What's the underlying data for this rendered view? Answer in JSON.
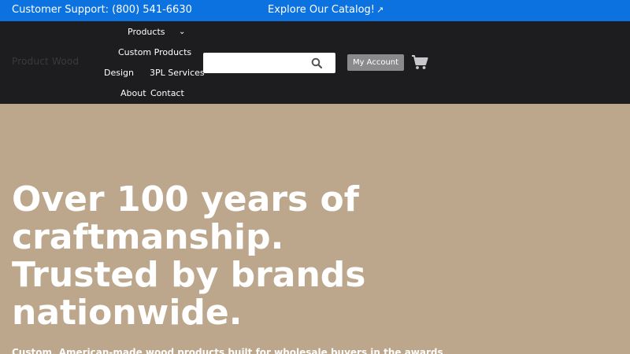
{
  "topbar": {
    "support_text": "Customer Support: (800) 541-6630",
    "catalog_text": "Explore Our Catalog!",
    "catalog_icon": "external-link-icon"
  },
  "header": {
    "logo_text": "Product Wood",
    "nav": {
      "products": "Products",
      "custom_products": "Custom Products",
      "design": "Design",
      "three_pl": "3PL Services",
      "about": "About",
      "contact": "Contact"
    },
    "search": {
      "placeholder": "",
      "value": ""
    },
    "account_label": "My Account",
    "icons": {
      "search": "search-icon",
      "cart": "cart-icon",
      "chevron": "chevron-down-icon"
    }
  },
  "hero": {
    "title_lines": [
      "Over 100 years of",
      "craftmanship.",
      "Trusted by brands",
      "nationwide."
    ],
    "subtitle": "Custom, American-made wood products built for wholesale buyers in the awards"
  },
  "colors": {
    "topbar_bg": "#0c72e0",
    "header_bg": "#1d1d1f",
    "hero_bg": "#bca78c",
    "account_btn_bg": "#8a8a8c"
  }
}
